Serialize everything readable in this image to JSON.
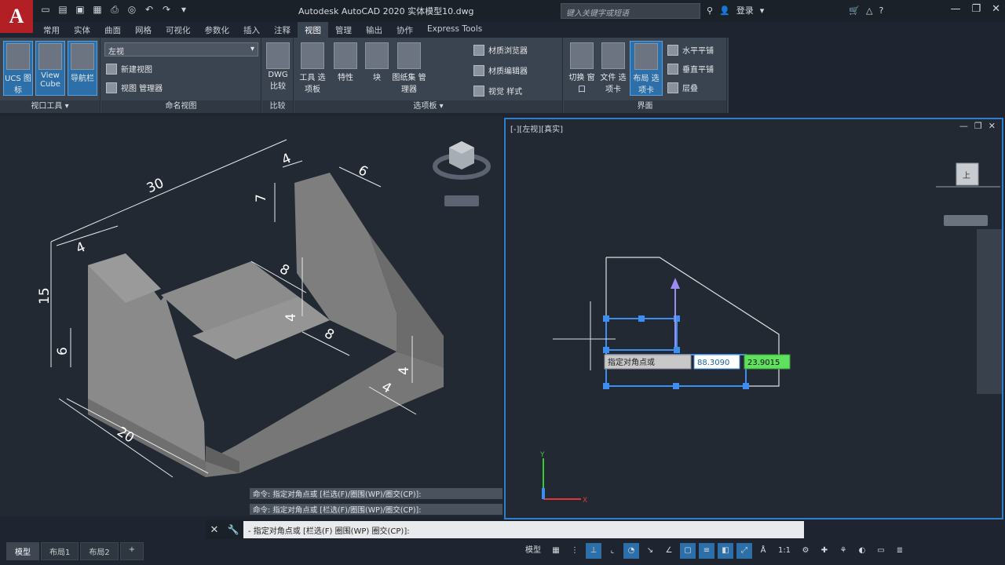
{
  "window": {
    "logo_letter": "A",
    "title": "Autodesk AutoCAD 2020    实体模型10.dwg",
    "search_placeholder": "键入关键字或短语",
    "user_label": "登录",
    "controls": [
      "—",
      "❐",
      "✕"
    ]
  },
  "ribbon": {
    "tabs": [
      "常用",
      "实体",
      "曲面",
      "网格",
      "可视化",
      "参数化",
      "插入",
      "注释",
      "视图",
      "管理",
      "输出",
      "协作",
      "Express Tools"
    ],
    "active_tab": "视图",
    "panels": {
      "viewport_tools": {
        "label": "视口工具 ▾",
        "buttons": [
          "UCS 图标",
          "View Cube",
          "导航栏"
        ]
      },
      "named_views": {
        "label": "命名视图",
        "combo_value": "左视",
        "items": [
          "新建视图",
          "视图 管理器"
        ]
      },
      "compare": {
        "label": "比较",
        "buttons": [
          "DWG 比较"
        ]
      },
      "palettes": {
        "label": "选项板 ▾",
        "buttons": [
          "工具 选项板",
          "特性",
          "块",
          "图纸集 管理器"
        ],
        "items": [
          "材质浏览器",
          "材质编辑器",
          "视觉 样式"
        ]
      },
      "interface": {
        "label": "界面",
        "buttons": [
          "切换 窗口",
          "文件 选项卡",
          "布局 选项卡"
        ],
        "items": [
          "水平平铺",
          "垂直平铺",
          "层叠"
        ]
      }
    }
  },
  "left_view": {
    "dimensions": [
      "30",
      "4",
      "6",
      "7",
      "4",
      "15",
      "8",
      "4",
      "6",
      "8",
      "4",
      "4",
      "20"
    ]
  },
  "right_view": {
    "label": "[-][左视][真实]",
    "controls": [
      "—",
      "❐",
      "✕"
    ],
    "viewcube_face": "上",
    "tooltip_prompt": "指定对角点或",
    "input_x": "88.3090",
    "input_y": "23.9015",
    "ucs_y": "Y",
    "ucs_x": "X"
  },
  "command": {
    "history": [
      "命令: 指定对角点或 [栏选(F)/圈围(WP)/圈交(CP)]:",
      "命令: 指定对角点或 [栏选(F)/圈围(WP)/圈交(CP)]:"
    ],
    "prompt": "- 指定对角点或 [栏选(F) 圈围(WP) 圈交(CP)]:"
  },
  "status": {
    "layout_tabs": [
      "模型",
      "布局1",
      "布局2",
      "+"
    ],
    "model_label": "模型",
    "scale_label": "1:1"
  },
  "colors": {
    "accent": "#2f7fd0",
    "logo": "#b21f25",
    "tooltip_green": "#5fe05f"
  }
}
